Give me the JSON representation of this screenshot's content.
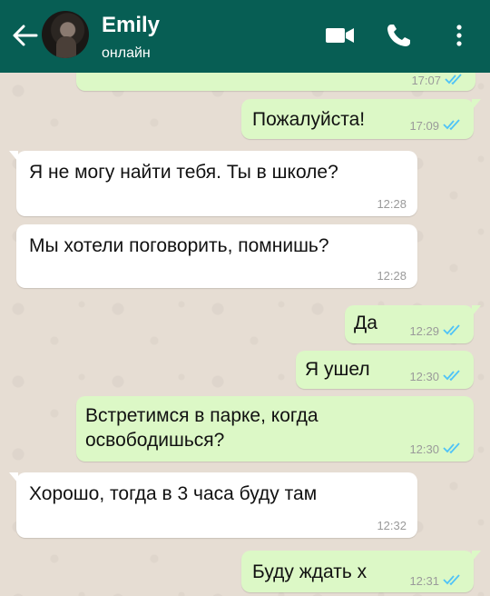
{
  "header": {
    "name": "Emily",
    "status": "онлайн"
  },
  "colors": {
    "header": "#075e54",
    "outgoing_bubble": "#dcf8c6",
    "incoming_bubble": "#ffffff",
    "read_ticks": "#4fc3f7",
    "chat_background": "#e6ddd3"
  },
  "icons": [
    "back-arrow-icon",
    "video-call-icon",
    "voice-call-icon",
    "more-options-icon",
    "double-check-icon"
  ],
  "messages": [
    {
      "direction": "out",
      "text": "",
      "time": "17:07",
      "read": true
    },
    {
      "direction": "out",
      "text": "Пожалуйста!",
      "time": "17:09",
      "read": true
    },
    {
      "direction": "in",
      "text": "Я не могу найти тебя. Ты в школе?",
      "time": "12:28"
    },
    {
      "direction": "in",
      "text": "Мы хотели поговорить, помнишь?",
      "time": "12:28"
    },
    {
      "direction": "out",
      "text": "Да",
      "time": "12:29",
      "read": true
    },
    {
      "direction": "out",
      "text": "Я ушел",
      "time": "12:30",
      "read": true
    },
    {
      "direction": "out",
      "text": "Встретимся в парке, когда освободишься?",
      "time": "12:30",
      "read": true
    },
    {
      "direction": "in",
      "text": "Хорошо, тогда в 3 часа буду там",
      "time": "12:32"
    },
    {
      "direction": "out",
      "text": "Буду ждать х",
      "time": "12:31",
      "read": true
    }
  ]
}
